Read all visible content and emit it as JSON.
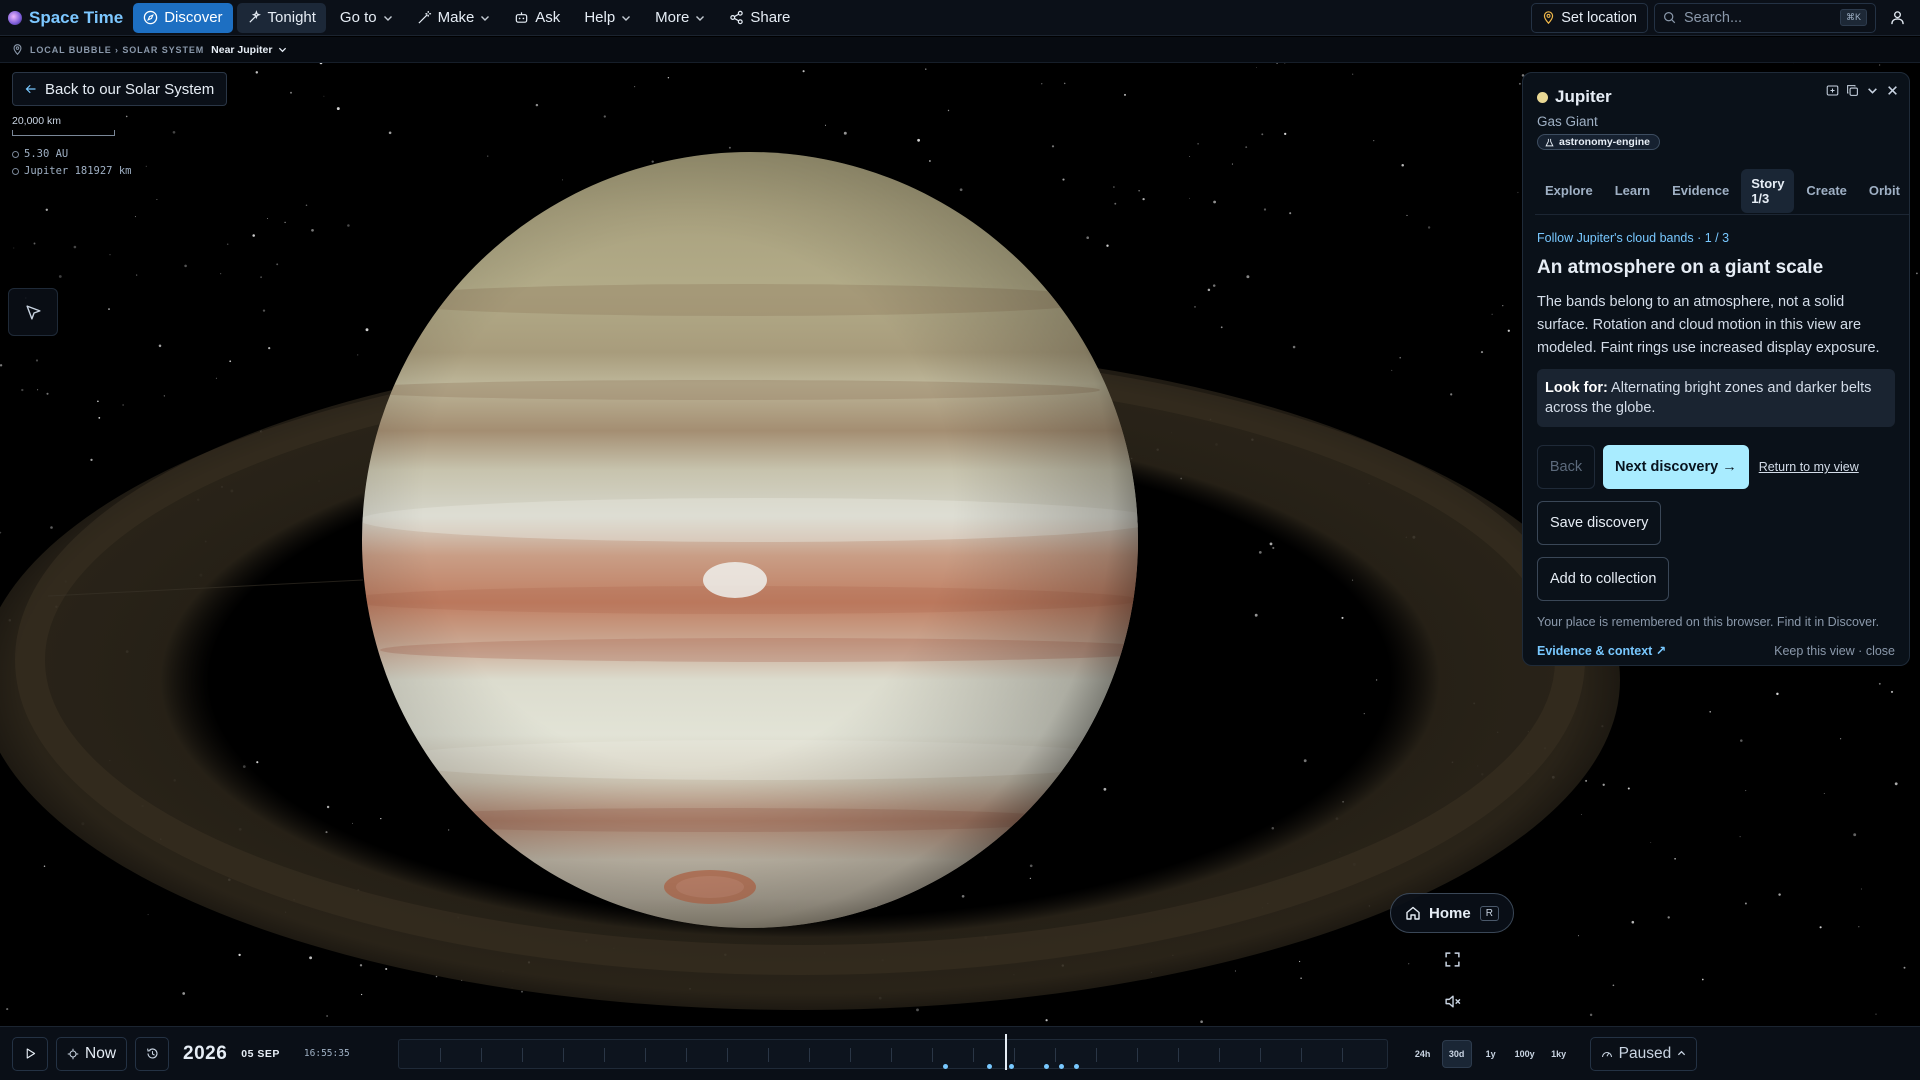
{
  "topbar": {
    "brand": "Space Time",
    "nav": [
      {
        "label": "Discover",
        "icon": "compass-icon"
      },
      {
        "label": "Tonight",
        "icon": "sparkle-icon"
      },
      {
        "label": "Go to",
        "icon": ""
      },
      {
        "label": "Make",
        "icon": "wand-icon"
      },
      {
        "label": "Ask",
        "icon": "robot-icon"
      },
      {
        "label": "Help",
        "icon": ""
      },
      {
        "label": "More",
        "icon": ""
      },
      {
        "label": "Share",
        "icon": "share-icon"
      }
    ],
    "set_location": "Set location",
    "search_placeholder": "Search...",
    "search_shortcut": "⌘K"
  },
  "breadcrumb": {
    "path": "LOCAL BUBBLE › SOLAR SYSTEM",
    "current": "Near Jupiter"
  },
  "overlay": {
    "back_button": "Back to our Solar System",
    "scale_label": "20,000 km",
    "distance_sun": "5.30 AU",
    "distance_target": "Jupiter 181927 km"
  },
  "panel": {
    "title": "Jupiter",
    "subtitle": "Gas Giant",
    "badge": "astronomy-engine",
    "tabs": [
      "Explore",
      "Learn",
      "Evidence",
      "Story 1/3",
      "Create",
      "Orbit"
    ],
    "active_tab": "Story 1/3",
    "story_kicker": "Follow Jupiter's cloud bands · 1 / 3",
    "story_title": "An atmosphere on a giant scale",
    "story_text": "The bands belong to an atmosphere, not a solid surface. Rotation and cloud motion in this view are modeled. Faint rings use increased display exposure.",
    "lookfor_label": "Look for:",
    "lookfor_text": " Alternating bright zones and darker belts across the globe.",
    "back_label": "Back",
    "next_label": "Next discovery →",
    "return_label": "Return to my view",
    "save_label": "Save discovery",
    "collection_label": "Add to collection",
    "note": "Your place is remembered on this browser. Find it in Discover.",
    "evidence_link": "Evidence & context ↗",
    "keep_link": "Keep this view · close"
  },
  "controls": {
    "home_label": "Home",
    "home_shortcut": "R"
  },
  "timeline": {
    "now_label": "Now",
    "year": "2026",
    "date": "05 SEP",
    "time": "16:55:35",
    "zooms": [
      "24h",
      "30d",
      "1y",
      "100y",
      "1ky"
    ],
    "active_zoom": "30d",
    "status": "Paused"
  },
  "colors": {
    "accent": "#1d6fc2",
    "link": "#78c8ff",
    "primary_button": "#a9ecff",
    "panel_bg": "#0a1119"
  }
}
